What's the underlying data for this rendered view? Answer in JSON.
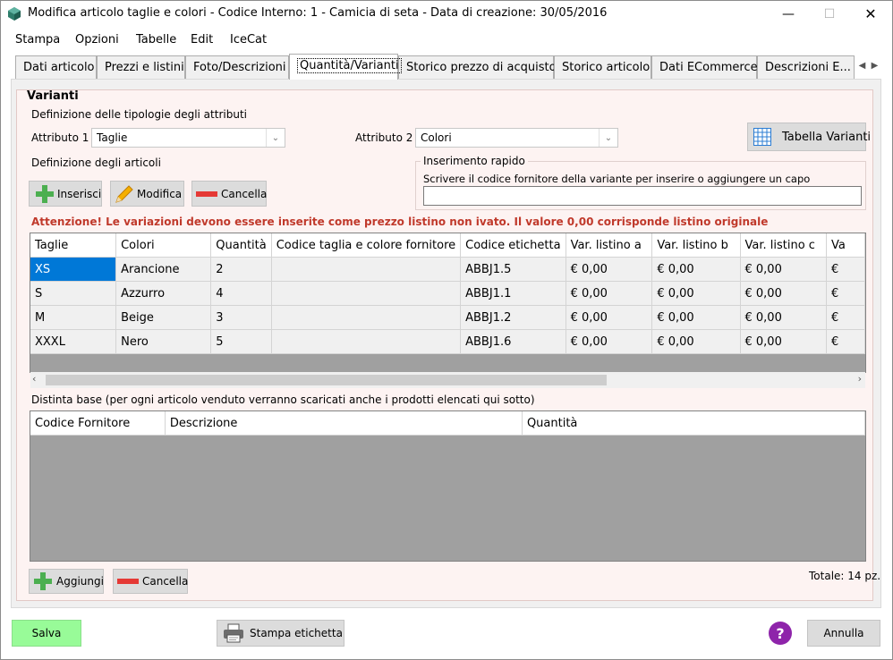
{
  "window": {
    "title": "Modifica articolo taglie e colori - Codice Interno: 1 - Camicia di seta - Data di creazione: 30/05/2016",
    "minimize": "—",
    "maximize": "☐",
    "close": "✕"
  },
  "menu": [
    "Stampa",
    "Opzioni",
    "Tabelle",
    "Edit",
    "IceCat"
  ],
  "tabs": [
    "Dati articolo",
    "Prezzi e listini",
    "Foto/Descrizioni",
    "Quantità/Varianti",
    "Storico prezzo di acquisto",
    "Storico articolo",
    "Dati ECommerce",
    "Descrizioni E..."
  ],
  "active_tab": "Quantità/Varianti",
  "tab_scroll": {
    "left": "◀",
    "right": "▶"
  },
  "varianti": {
    "group_title": "Varianti",
    "attr_def_label": "Definizione delle tipologie degli attributi",
    "attr1_label": "Attributo 1",
    "attr1_value": "Taglie",
    "attr2_label": "Attributo 2",
    "attr2_value": "Colori",
    "tabella_varianti": "Tabella Varianti",
    "articoli_def_label": "Definizione degli articoli",
    "inserisci": "Inserisci",
    "modifica": "Modifica",
    "cancella": "Cancella",
    "rapido_title": "Inserimento rapido",
    "rapido_hint": "Scrivere il codice fornitore della variante per inserire o aggiungere un capo",
    "rapido_value": "",
    "warning": "Attenzione! Le variazioni devono essere inserite come prezzo listino non ivato. Il valore 0,00 corrisponde listino originale"
  },
  "variants_table": {
    "columns": [
      "Taglie",
      "Colori",
      "Quantità",
      "Codice taglia e colore fornitore",
      "Codice etichetta",
      "Var. listino a",
      "Var. listino b",
      "Var. listino c",
      "Va"
    ],
    "rows": [
      [
        "XS",
        "Arancione",
        "2",
        "",
        "ABBJ1.5",
        "€ 0,00",
        "€ 0,00",
        "€ 0,00",
        "€"
      ],
      [
        "S",
        "Azzurro",
        "4",
        "",
        "ABBJ1.1",
        "€ 0,00",
        "€ 0,00",
        "€ 0,00",
        "€"
      ],
      [
        "M",
        "Beige",
        "3",
        "",
        "ABBJ1.2",
        "€ 0,00",
        "€ 0,00",
        "€ 0,00",
        "€"
      ],
      [
        "XXXL",
        "Nero",
        "5",
        "",
        "ABBJ1.6",
        "€ 0,00",
        "€ 0,00",
        "€ 0,00",
        "€"
      ]
    ]
  },
  "distinta": {
    "label": "Distinta base (per ogni articolo venduto verranno scaricati anche i prodotti elencati qui sotto)",
    "columns": [
      "Codice Fornitore",
      "Descrizione",
      "Quantità"
    ],
    "aggiungi": "Aggiungi",
    "cancella": "Cancella",
    "totale": "Totale: 14 pz."
  },
  "footer": {
    "salva": "Salva",
    "stampa_etichetta": "Stampa etichetta",
    "help": "?",
    "annulla": "Annulla"
  },
  "colors": {
    "selection": "#0078d7",
    "warning": "#c0392b",
    "save_button": "#98fb98",
    "help_icon": "#8e24aa",
    "group_bg": "#fdf3f2"
  }
}
